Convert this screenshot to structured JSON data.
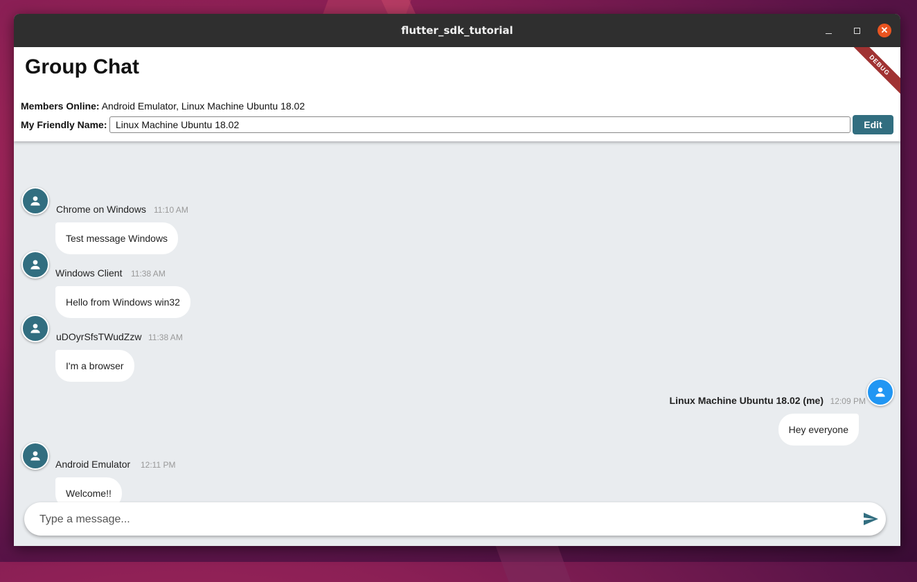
{
  "window": {
    "title": "flutter_sdk_tutorial"
  },
  "header": {
    "page_title": "Group Chat",
    "members_label": "Members Online:",
    "members_value": "Android Emulator, Linux Machine Ubuntu 18.02",
    "friendly_name_label": "My Friendly Name:",
    "friendly_name_value": "Linux Machine Ubuntu 18.02",
    "edit_label": "Edit",
    "debug_banner": "DEBUG"
  },
  "messages": [
    {
      "sender": "Chrome on Windows",
      "time": "11:10 AM",
      "text": "Test message Windows",
      "is_me": false
    },
    {
      "sender": "Windows Client",
      "time": "11:38 AM",
      "text": "Hello from Windows win32",
      "is_me": false
    },
    {
      "sender": "uDOyrSfsTWudZzw",
      "time": "11:38 AM",
      "text": "I'm a browser",
      "is_me": false
    },
    {
      "sender": "Linux Machine Ubuntu 18.02 (me)",
      "time": "12:09 PM",
      "text": "Hey everyone",
      "is_me": true
    },
    {
      "sender": "Android Emulator",
      "time": "12:11 PM",
      "text": "Welcome!!",
      "is_me": false
    }
  ],
  "composer": {
    "placeholder": "Type a message..."
  },
  "colors": {
    "accent": "#326e80",
    "me_avatar": "#2196f3",
    "close_button": "#e95420",
    "debug_ribbon": "#a03232"
  },
  "icons": {
    "avatar": "person-icon",
    "send": "send-icon"
  }
}
